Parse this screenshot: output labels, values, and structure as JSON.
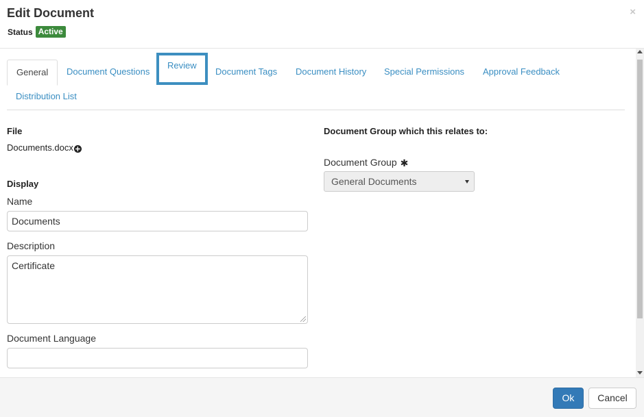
{
  "header": {
    "title": "Edit Document",
    "status_label": "Status",
    "status_value": "Active",
    "close_label": "×"
  },
  "tabs": [
    {
      "label": "General",
      "active": true
    },
    {
      "label": "Document Questions"
    },
    {
      "label": "Review",
      "highlighted": true
    },
    {
      "label": "Document Tags"
    },
    {
      "label": "Document History"
    },
    {
      "label": "Special Permissions"
    },
    {
      "label": "Approval Feedback"
    },
    {
      "label": "Distribution List"
    }
  ],
  "file": {
    "heading": "File",
    "name": "Documents.docx"
  },
  "display": {
    "heading": "Display",
    "name_label": "Name",
    "name_value": "Documents",
    "description_label": "Description",
    "description_value": "Certificate",
    "language_label": "Document Language",
    "language_value": ""
  },
  "group": {
    "heading": "Document Group which this relates to:",
    "label": "Document Group",
    "required_mark": "✱",
    "selected": "General Documents"
  },
  "footer": {
    "ok_label": "Ok",
    "cancel_label": "Cancel"
  },
  "colors": {
    "accent": "#337ab7",
    "link": "#3a8ec2",
    "status_green": "#3c8a3c",
    "highlight_border": "#3d8fc0"
  }
}
